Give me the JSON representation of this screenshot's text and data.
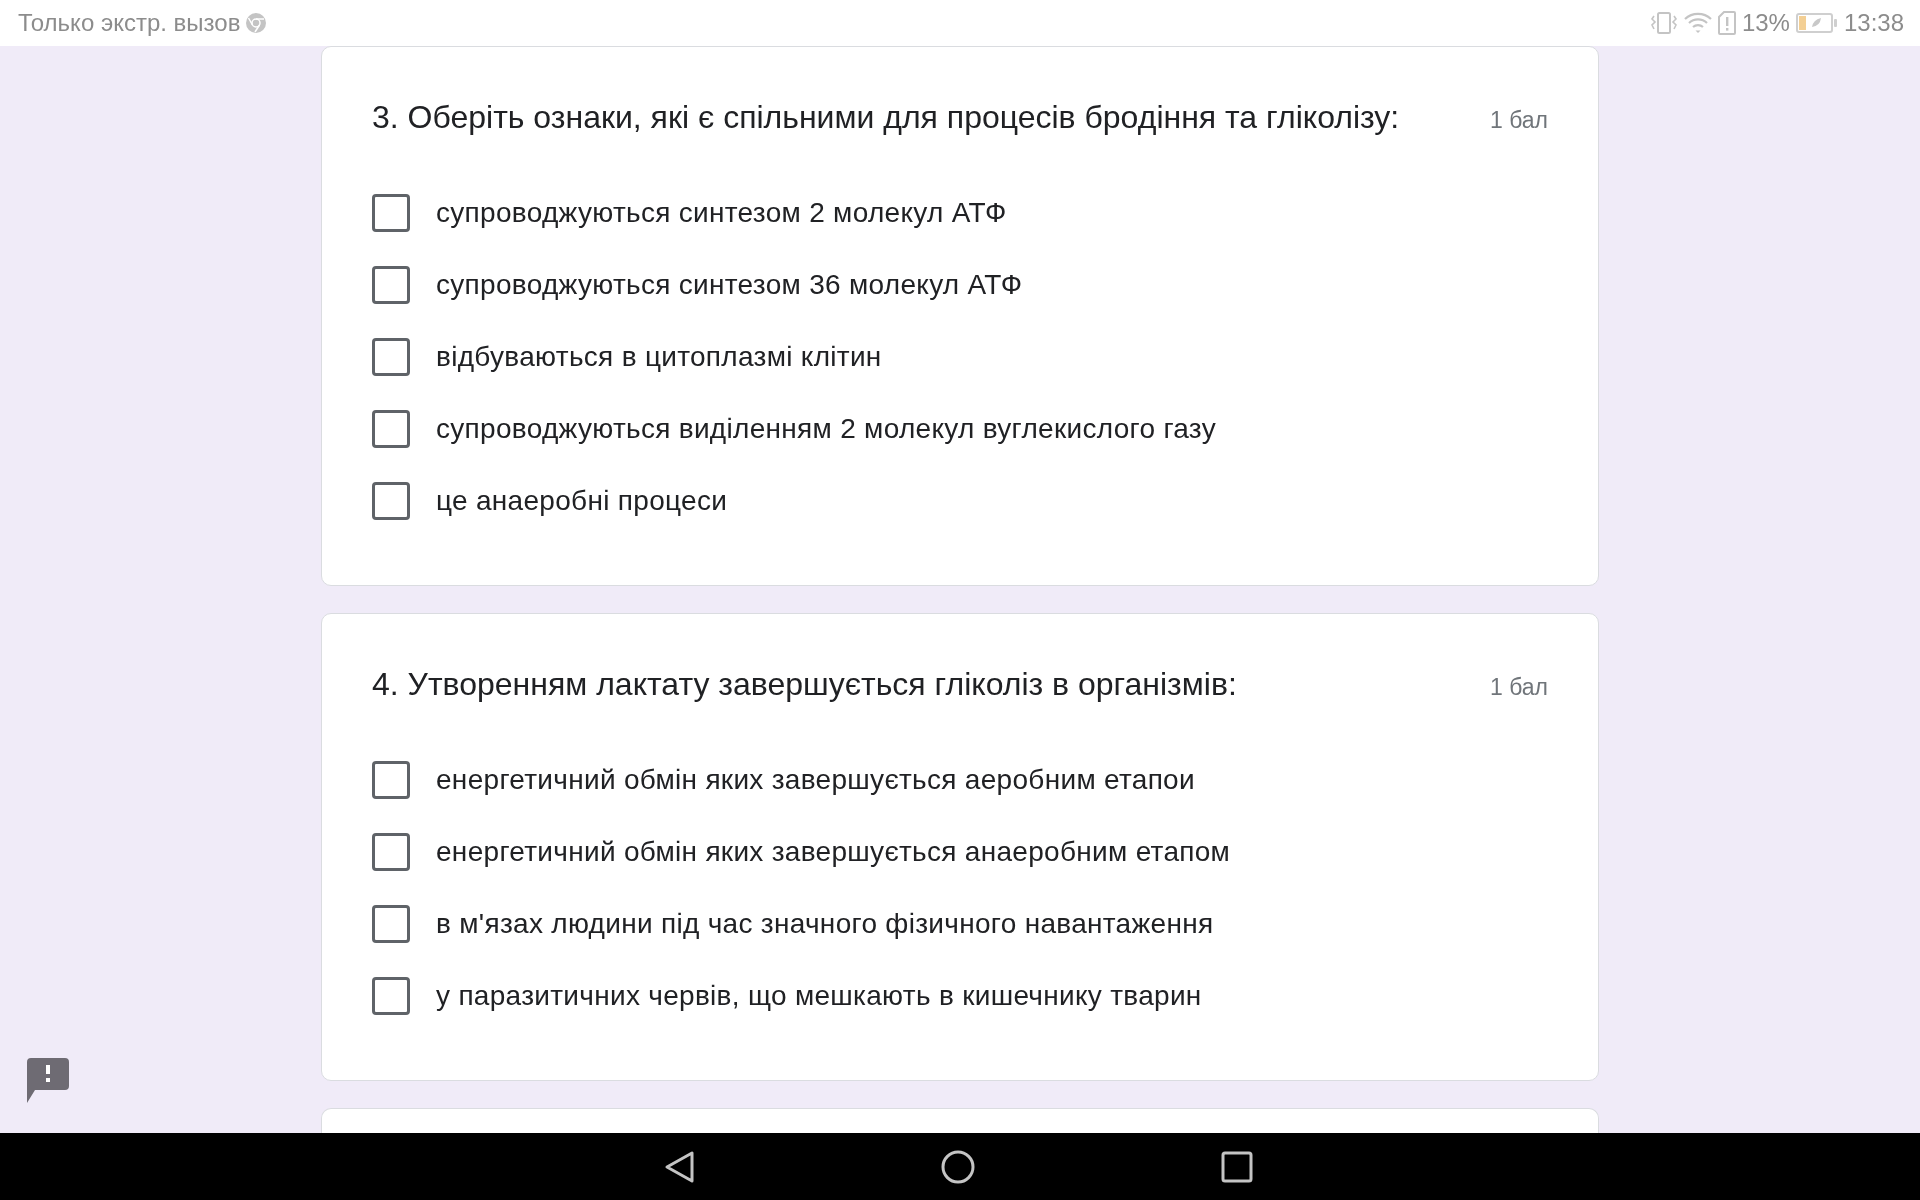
{
  "status_bar": {
    "carrier_text": "Только экстр. вызов",
    "battery_percent": "13%",
    "time": "13:38"
  },
  "questions": [
    {
      "title": "3. Оберіть ознаки, які є спільними для процесів бродіння та гліколізу:",
      "points": "1 бал",
      "options": [
        {
          "label": "супроводжуються синтезом 2 молекул АТФ",
          "checked": false
        },
        {
          "label": "супроводжуються синтезом 36 молекул АТФ",
          "checked": false
        },
        {
          "label": "відбуваються в цитоплазмі клітин",
          "checked": false
        },
        {
          "label": "супроводжуються виділенням 2 молекул вуглекислого газу",
          "checked": false
        },
        {
          "label": "це анаеробні процеси",
          "checked": false
        }
      ]
    },
    {
      "title": "4. Утворенням лактату завершується гліколіз в організмів:",
      "points": "1 бал",
      "options": [
        {
          "label": "енергетичний обмін яких завершується аеробним етапои",
          "checked": false
        },
        {
          "label": "енергетичний обмін яких завершується анаеробним етапом",
          "checked": false
        },
        {
          "label": "в м'язах людини під час значного фізичного навантаження",
          "checked": false
        },
        {
          "label": "у паразитичних червів, що мешкають в кишечнику тварин",
          "checked": false
        }
      ]
    }
  ]
}
